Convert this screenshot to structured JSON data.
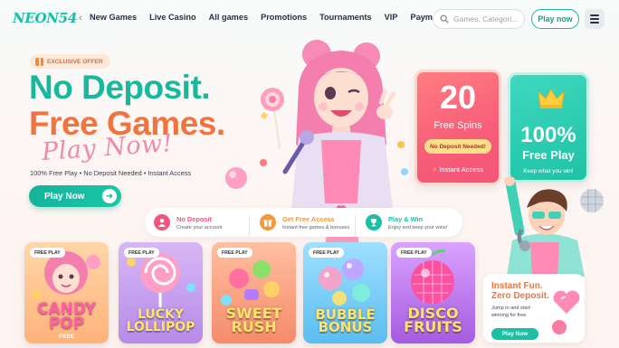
{
  "header": {
    "logo": "NEON54",
    "nav": [
      "New Games",
      "Live Casino",
      "All games",
      "Promotions",
      "Tournaments",
      "VIP",
      "Payments"
    ],
    "search_placeholder": "Games, Categori...",
    "play_now": "Play now"
  },
  "hero": {
    "badge": "EXCLUSIVE OFFER",
    "line1": "No Deposit.",
    "line2": "Free Games.",
    "script": "Play Now!",
    "features": "100% Free Play • No Deposit Needed • Instant Access",
    "cta": "Play Now"
  },
  "promos": {
    "spins": {
      "number": "20",
      "label": "Free Spins",
      "pill": "No Deposit Needed!",
      "footer": "Instant Access"
    },
    "play": {
      "percent": "100%",
      "label": "Free Play",
      "sub": "Keep what you win!"
    }
  },
  "features": [
    {
      "title": "No Deposit",
      "sub": "Create your account",
      "icon": "user-icon",
      "color": "#f1577e"
    },
    {
      "title": "Get Free Access",
      "sub": "Instant free games & bonuses",
      "icon": "gift-icon",
      "color": "#f5973e"
    },
    {
      "title": "Play & Win",
      "sub": "Enjoy and keep your wins!",
      "icon": "trophy-icon",
      "color": "#1bbfa6"
    }
  ],
  "games": [
    {
      "tag": "FREE PLAY",
      "line1": "CANDY",
      "line2": "POP",
      "sub": "FREE"
    },
    {
      "tag": "FREE PLAY",
      "line1": "LUCKY",
      "line2": "LOLLIPOP",
      "sub": ""
    },
    {
      "tag": "FREE PLAY",
      "line1": "SWEET",
      "line2": "RUSH",
      "sub": ""
    },
    {
      "tag": "FREE PLAY",
      "line1": "BUBBLE",
      "line2": "BONUS",
      "sub": ""
    },
    {
      "tag": "FREE PLAY",
      "line1": "DISCO",
      "line2": "FRUITS",
      "sub": ""
    }
  ],
  "side_promo": {
    "title1": "Instant Fun.",
    "title2": "Zero Deposit.",
    "sub": "Jump in and start winning for free.",
    "button": "Play Now"
  },
  "colors": {
    "teal": "#19b89d",
    "orange": "#f1743e",
    "pink": "#f55577"
  }
}
